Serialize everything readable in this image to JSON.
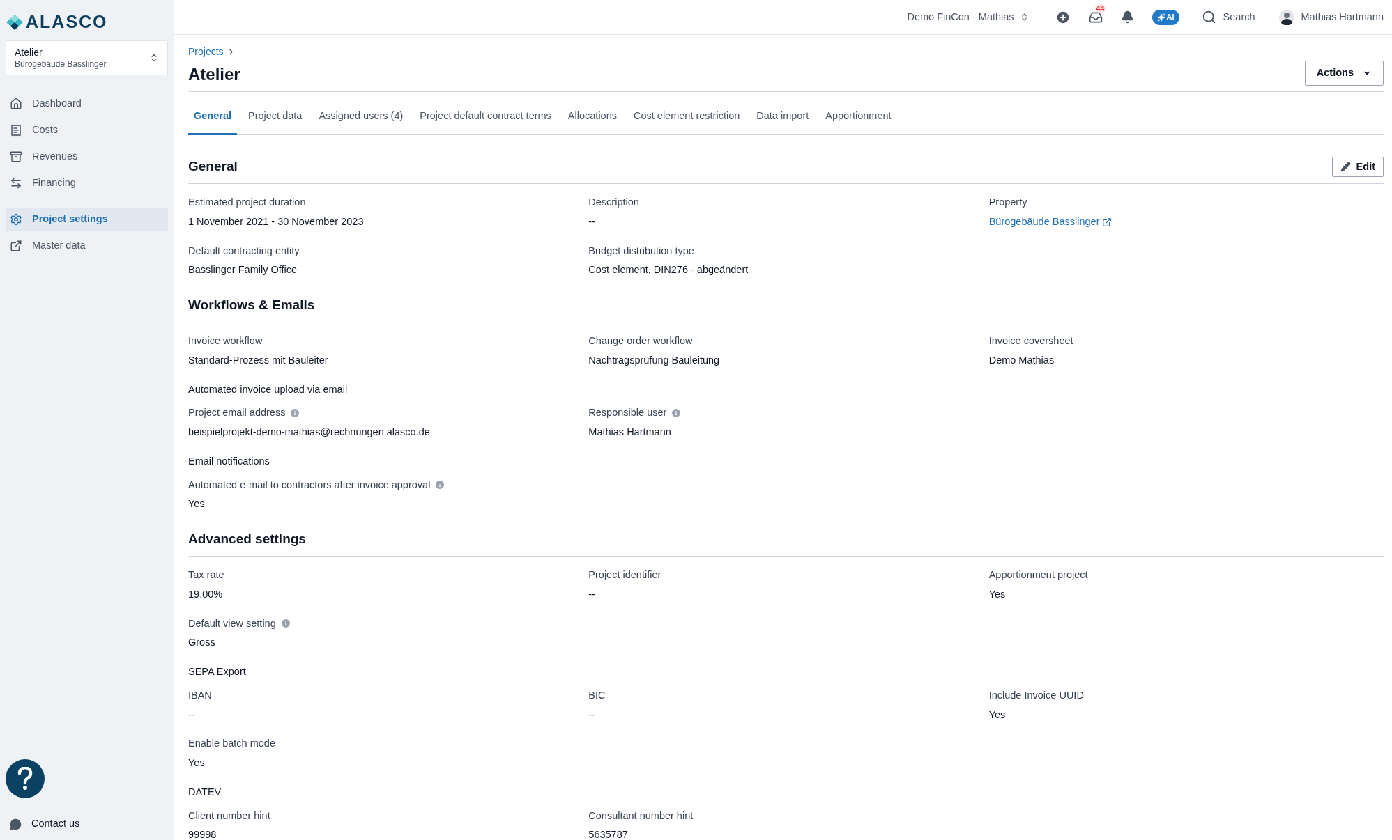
{
  "logo": {
    "text": "ALASCO"
  },
  "project_switcher": {
    "name": "Atelier",
    "property": "Bürogebäude Basslinger"
  },
  "sidebar": {
    "items": [
      {
        "label": "Dashboard",
        "selected": false
      },
      {
        "label": "Costs",
        "selected": false
      },
      {
        "label": "Revenues",
        "selected": false
      },
      {
        "label": "Financing",
        "selected": false
      },
      {
        "label": "Project settings",
        "selected": true
      },
      {
        "label": "Master data",
        "selected": false
      }
    ],
    "contact": "Contact us"
  },
  "topbar": {
    "workspace": "Demo FinCon - Mathias",
    "inbox_count": "44",
    "ai_label": "AI",
    "search": "Search",
    "user": "Mathias Hartmann"
  },
  "breadcrumb": [
    "Projects"
  ],
  "title": "Atelier",
  "actions_button": "Actions",
  "tabs": [
    {
      "label": "General",
      "selected": true
    },
    {
      "label": "Project data",
      "selected": false
    },
    {
      "label": "Assigned users (4)",
      "selected": false
    },
    {
      "label": "Project default contract terms",
      "selected": false
    },
    {
      "label": "Allocations",
      "selected": false
    },
    {
      "label": "Cost element restriction",
      "selected": false
    },
    {
      "label": "Data import",
      "selected": false
    },
    {
      "label": "Apportionment",
      "selected": false
    }
  ],
  "sections": [
    {
      "title": "General",
      "edit_button": "Edit",
      "blocks": [
        {
          "kind": "row",
          "fields": [
            {
              "label": "Estimated project duration",
              "value": "1 November 2021 - 30 November 2023"
            },
            {
              "label": "Description",
              "value": "--"
            },
            {
              "label": "Property",
              "value": "Bürogebäude Basslinger",
              "link": true
            }
          ]
        },
        {
          "kind": "row",
          "fields": [
            {
              "label": "Default contracting entity",
              "value": "Basslinger Family Office"
            },
            {
              "label": "Budget distribution type",
              "value": "Cost element, DIN276 - abgeändert"
            }
          ]
        }
      ]
    },
    {
      "title": "Workflows & Emails",
      "blocks": [
        {
          "kind": "row",
          "fields": [
            {
              "label": "Invoice workflow",
              "value": "Standard-Prozess mit Bauleiter"
            },
            {
              "label": "Change order workflow",
              "value": "Nachtragsprüfung Bauleitung"
            },
            {
              "label": "Invoice coversheet",
              "value": "Demo Mathias"
            }
          ]
        },
        {
          "kind": "subheading",
          "text": "Automated invoice upload via email"
        },
        {
          "kind": "row",
          "fields": [
            {
              "label": "Project email address",
              "value": "beispielprojekt-demo-mathias@rechnungen.alasco.de",
              "info": true
            },
            {
              "label": "Responsible user",
              "value": "Mathias Hartmann",
              "info": true
            }
          ]
        },
        {
          "kind": "subheading",
          "text": "Email notifications"
        },
        {
          "kind": "row",
          "fields": [
            {
              "label": "Automated e-mail to contractors after invoice approval",
              "value": "Yes",
              "info": true
            }
          ]
        }
      ]
    },
    {
      "title": "Advanced settings",
      "blocks": [
        {
          "kind": "row",
          "fields": [
            {
              "label": "Tax rate",
              "value": "19.00%"
            },
            {
              "label": "Project identifier",
              "value": "--"
            },
            {
              "label": "Apportionment project",
              "value": "Yes"
            }
          ]
        },
        {
          "kind": "row",
          "fields": [
            {
              "label": "Default view setting",
              "value": "Gross",
              "info": true
            }
          ]
        },
        {
          "kind": "subheading",
          "text": "SEPA Export"
        },
        {
          "kind": "row",
          "fields": [
            {
              "label": "IBAN",
              "value": "--"
            },
            {
              "label": "BIC",
              "value": "--"
            },
            {
              "label": "Include Invoice UUID",
              "value": "Yes"
            }
          ]
        },
        {
          "kind": "row",
          "fields": [
            {
              "label": "Enable batch mode",
              "value": "Yes"
            }
          ]
        },
        {
          "kind": "subheading",
          "text": "DATEV"
        },
        {
          "kind": "row",
          "fields": [
            {
              "label": "Client number hint",
              "value": "99998"
            },
            {
              "label": "Consultant number hint",
              "value": "5635787"
            }
          ]
        }
      ]
    }
  ]
}
